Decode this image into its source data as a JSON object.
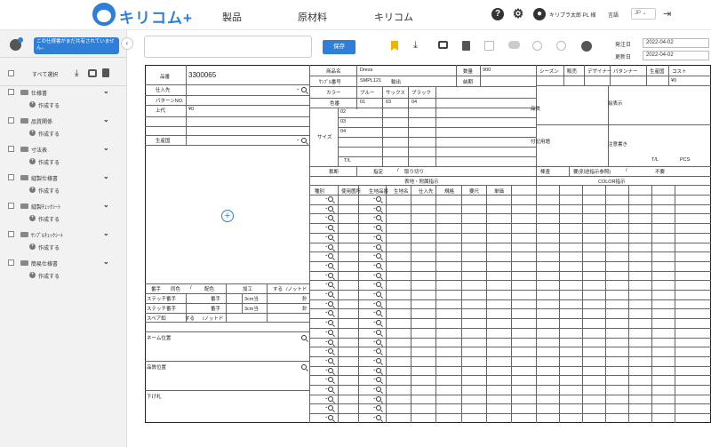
{
  "header": {
    "logo_text": "キリコム+",
    "nav": [
      "製品",
      "原材料",
      "キリコム"
    ],
    "user_name": "キリプラ太郎 PL 様",
    "lang_label": "言語",
    "lang_value": "JP"
  },
  "sidebar": {
    "tip": "この仕様書がまだ共有されていません。",
    "select_all": "すべて選択",
    "create_label": "作成する",
    "folders": [
      "仕様書",
      "品質関係",
      "寸法表",
      "縫製仕様書",
      "縫製ﾁｪｯｸｼｰﾄ",
      "ｻﾝﾌﾟﾙﾁｪｯｸｼｰﾄ",
      "簡易仕様書"
    ]
  },
  "toolbar": {
    "save_label": "保存",
    "order_date_label": "発注日",
    "order_date": "2022-04-02",
    "update_date_label": "更新日",
    "update_date": "2022-04-02"
  },
  "sheet": {
    "hinban_label": "品番",
    "hinban": "3300065",
    "left_labels": [
      "仕入先",
      "パターンNO.",
      "上代",
      "",
      "",
      "生産国"
    ],
    "jodai": "¥0",
    "bottom": {
      "row1": [
        "番手",
        "同色",
        "/",
        "配色",
        "加工",
        "する",
        "/ノットド"
      ],
      "row2": [
        "ステッチ番手",
        "番手",
        "3cm当",
        "針"
      ],
      "row3": [
        "ステッチ番手",
        "番手",
        "3cm当",
        "針"
      ],
      "row4": [
        "スペア釦",
        "する",
        "/ノットド"
      ],
      "name_pos": "ネーム位置",
      "quality_pos": "品質位置",
      "tag": "下げ札"
    },
    "product": {
      "name_label": "商品名",
      "name": "Dress",
      "sample_label": "ｻﾝﾌﾟﾙ番号",
      "sample": "SMPL121",
      "import_label": "輸出",
      "qty_label": "数量",
      "qty": "900",
      "due_label": "納期",
      "color_label": "カラー",
      "colors": [
        "ブルー",
        "サックス",
        "ブラック"
      ],
      "colorno_label": "色番",
      "color_nos": [
        "01",
        "03",
        "04"
      ],
      "size_label": "サイズ",
      "sizes": [
        "02",
        "03",
        "04"
      ],
      "tl_label": "T/L",
      "cut_label": "裁断",
      "cut_options": [
        "指定",
        "/",
        "取り切り"
      ],
      "trim_header": "表地・附属指示",
      "trim_cols": [
        "種別",
        "使用箇所",
        "生地品番",
        "生地名",
        "仕入先",
        "規格",
        "要尺",
        "単価"
      ]
    },
    "right": {
      "cols": [
        "シーズン",
        "販売",
        "デザイナー",
        "パタンナー",
        "生産国",
        "コスト"
      ],
      "cost": "¥0",
      "quality_label": "品質",
      "care_label": "絵表示",
      "notes_label": "付記用語",
      "price_tag_label": "注意書き",
      "tl_label": "T/L",
      "pcs_label": "PCS",
      "inspect_label": "棒査",
      "inspect_value": "要(別途指示参照)",
      "inspect_sep": "/",
      "inspect_no": "不要",
      "color_header": "COLOR指示"
    }
  }
}
